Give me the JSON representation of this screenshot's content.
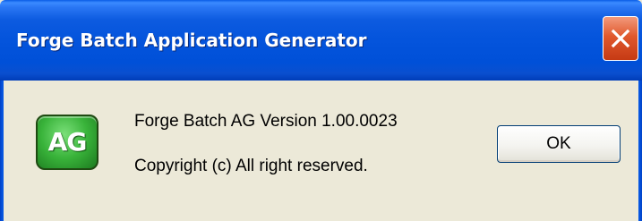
{
  "window": {
    "title": "Forge Batch Application Generator"
  },
  "app_icon": {
    "icon": "ag-app-icon",
    "label": "AG",
    "color": "#3DB33E"
  },
  "content": {
    "version": "Forge Batch AG Version 1.00.0023",
    "copyright": "Copyright (c) All right reserved."
  },
  "buttons": {
    "ok_label": "OK",
    "close_icon": "close-icon"
  },
  "colors": {
    "titlebar": "#0054E3",
    "close_button": "#E0582C",
    "dialog_background": "#ECE9D8"
  }
}
